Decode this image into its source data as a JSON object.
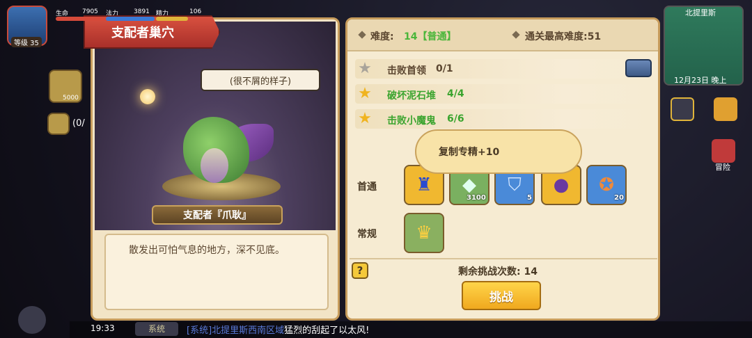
{
  "hud": {
    "level_label": "等级 35",
    "stats": [
      {
        "label": "生命",
        "value": "7905",
        "color": "#d64a3a"
      },
      {
        "label": "法力",
        "value": "3891",
        "color": "#3a7ad6"
      },
      {
        "label": "精力",
        "value": "106",
        "color": "#e0b43a"
      }
    ],
    "left_items": [
      {
        "icon": "gold-medal-icon",
        "count": "5000"
      },
      {
        "icon": "chat-icon",
        "count": "(0/"
      }
    ]
  },
  "left_panel": {
    "title": "支配者巢穴",
    "speech": "(很不屑的样子)",
    "boss_name": "支配者『爪耿』",
    "description": "散发出可怕气息的地方，深不见底。"
  },
  "right_panel": {
    "difficulty_label": "难度:",
    "difficulty_value": "14【普通】",
    "best_label": "通关最高难度:51",
    "quests": [
      {
        "text": "击败首领",
        "progress": "0/1",
        "done": false
      },
      {
        "text": "破坏泥石堆",
        "progress": "4/4",
        "done": true
      },
      {
        "text": "击败小魔鬼",
        "progress": "6/6",
        "done": true
      }
    ],
    "first_clear_label": "首通",
    "regular_label": "常规",
    "tooltip": "复制专精+10",
    "first_clear_rewards": [
      {
        "icon": "blue-robot-icon",
        "count": "",
        "bg": "#f0b830"
      },
      {
        "icon": "green-gem-icon",
        "count": "3100",
        "bg": "#7ab060"
      },
      {
        "icon": "blue-shield-icon",
        "count": "5",
        "bg": "#4a8ad8"
      },
      {
        "icon": "hero-portrait-icon",
        "count": "",
        "bg": "#f0b830"
      },
      {
        "icon": "bronze-medal-icon",
        "count": "20",
        "bg": "#4a8ad8"
      }
    ],
    "regular_rewards": [
      {
        "icon": "gold-crown-coin-icon",
        "count": "",
        "bg": "#8ab060"
      }
    ],
    "help": "?",
    "remaining": "剩余挑战次数: 14",
    "challenge": "挑战"
  },
  "close": "✕",
  "right_hud": {
    "map_title": "北提里斯",
    "date": "12月23日 晚上",
    "adventure": "冒险"
  },
  "bottom": {
    "time": "19:33",
    "tab": "系统",
    "msg_tag": "[系统]",
    "msg_place": "北提里斯西南区域",
    "msg_rest": "猛烈的刮起了以太风!"
  }
}
